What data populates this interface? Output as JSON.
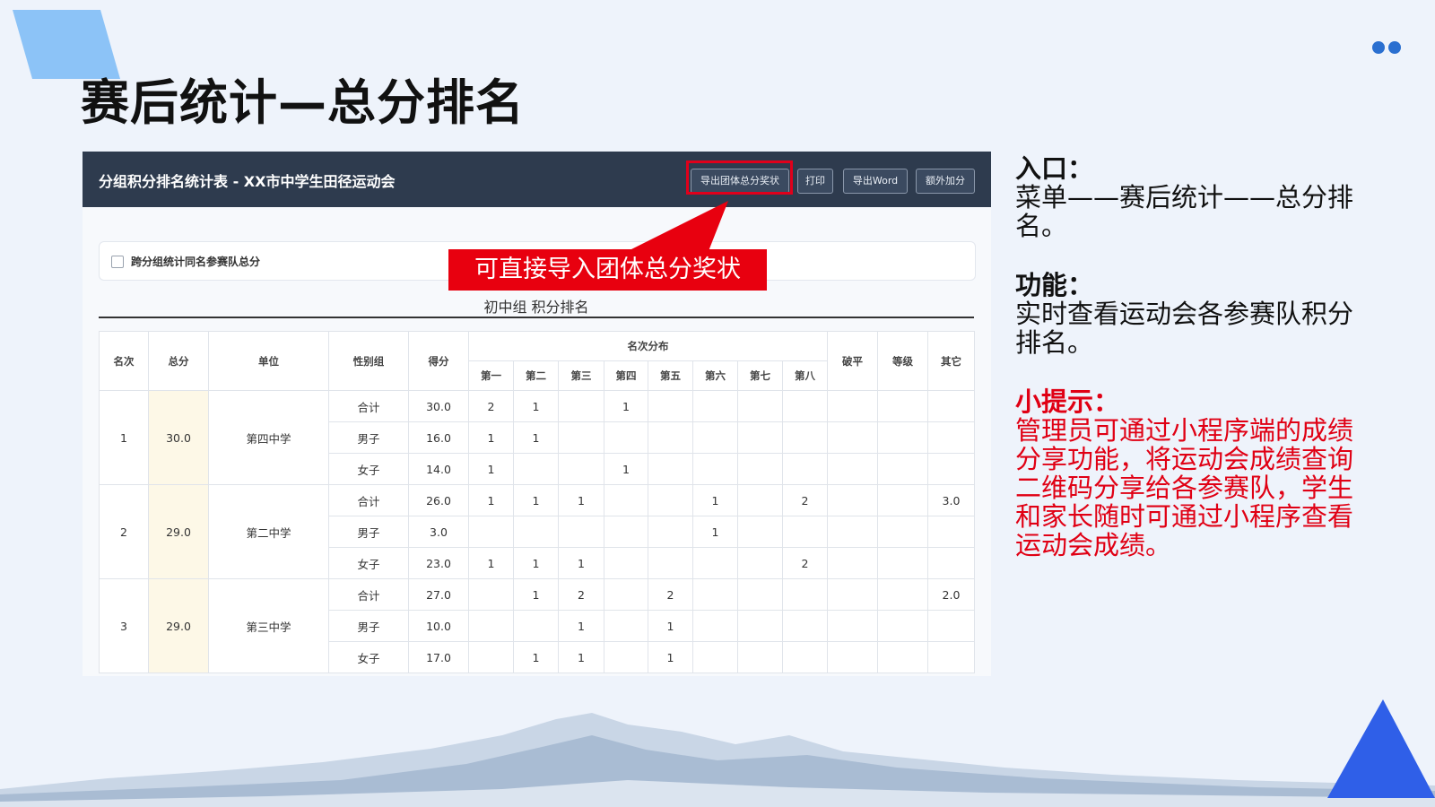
{
  "slide": {
    "title": "赛后统计—总分排名",
    "accent_color": "#2a6fd0"
  },
  "panel": {
    "title": "分组积分排名统计表 - XX市中学生田径运动会",
    "buttons": [
      "导出团体总分奖状",
      "打印",
      "导出Word",
      "额外加分"
    ],
    "checkbox_label": "跨分组统计同名参赛队总分",
    "checkbox_checked": false,
    "group_title": "初中组 积分排名"
  },
  "callout": {
    "text": "可直接导入团体总分奖状",
    "color": "#e8000f"
  },
  "table": {
    "headers": {
      "rank": "名次",
      "total": "总分",
      "unit": "单位",
      "gender": "性别组",
      "score": "得分",
      "distribution": "名次分布",
      "places": [
        "第一",
        "第二",
        "第三",
        "第四",
        "第五",
        "第六",
        "第七",
        "第八"
      ],
      "record": "破平",
      "level": "等级",
      "other": "其它"
    },
    "teams": [
      {
        "rank": "1",
        "total": "30.0",
        "unit": "第四中学",
        "rows": [
          {
            "gender": "合计",
            "score": "30.0",
            "places": [
              "2",
              "1",
              "",
              "1",
              "",
              "",
              "",
              ""
            ],
            "record": "",
            "level": "",
            "other": ""
          },
          {
            "gender": "男子",
            "score": "16.0",
            "places": [
              "1",
              "1",
              "",
              "",
              "",
              "",
              "",
              ""
            ],
            "record": "",
            "level": "",
            "other": ""
          },
          {
            "gender": "女子",
            "score": "14.0",
            "places": [
              "1",
              "",
              "",
              "1",
              "",
              "",
              "",
              ""
            ],
            "record": "",
            "level": "",
            "other": ""
          }
        ]
      },
      {
        "rank": "2",
        "total": "29.0",
        "unit": "第二中学",
        "rows": [
          {
            "gender": "合计",
            "score": "26.0",
            "places": [
              "1",
              "1",
              "1",
              "",
              "",
              "1",
              "",
              "2"
            ],
            "record": "",
            "level": "",
            "other": "3.0"
          },
          {
            "gender": "男子",
            "score": "3.0",
            "places": [
              "",
              "",
              "",
              "",
              "",
              "1",
              "",
              ""
            ],
            "record": "",
            "level": "",
            "other": ""
          },
          {
            "gender": "女子",
            "score": "23.0",
            "places": [
              "1",
              "1",
              "1",
              "",
              "",
              "",
              "",
              "2"
            ],
            "record": "",
            "level": "",
            "other": ""
          }
        ]
      },
      {
        "rank": "3",
        "total": "29.0",
        "unit": "第三中学",
        "rows": [
          {
            "gender": "合计",
            "score": "27.0",
            "places": [
              "",
              "1",
              "2",
              "",
              "2",
              "",
              "",
              ""
            ],
            "record": "",
            "level": "",
            "other": "2.0"
          },
          {
            "gender": "男子",
            "score": "10.0",
            "places": [
              "",
              "",
              "1",
              "",
              "1",
              "",
              "",
              ""
            ],
            "record": "",
            "level": "",
            "other": ""
          },
          {
            "gender": "女子",
            "score": "17.0",
            "places": [
              "",
              "1",
              "1",
              "",
              "1",
              "",
              "",
              ""
            ],
            "record": "",
            "level": "",
            "other": ""
          }
        ]
      }
    ]
  },
  "side": {
    "entry_heading": "入口：",
    "entry_text": "菜单——赛后统计——总分排名。",
    "function_heading": "功能：",
    "function_text": "实时查看运动会各参赛队积分排名。",
    "tip_heading": "小提示：",
    "tip_text": "管理员可通过小程序端的成绩分享功能，将运动会成绩查询二维码分享给各参赛队，学生和家长随时可通过小程序查看运动会成绩。"
  }
}
